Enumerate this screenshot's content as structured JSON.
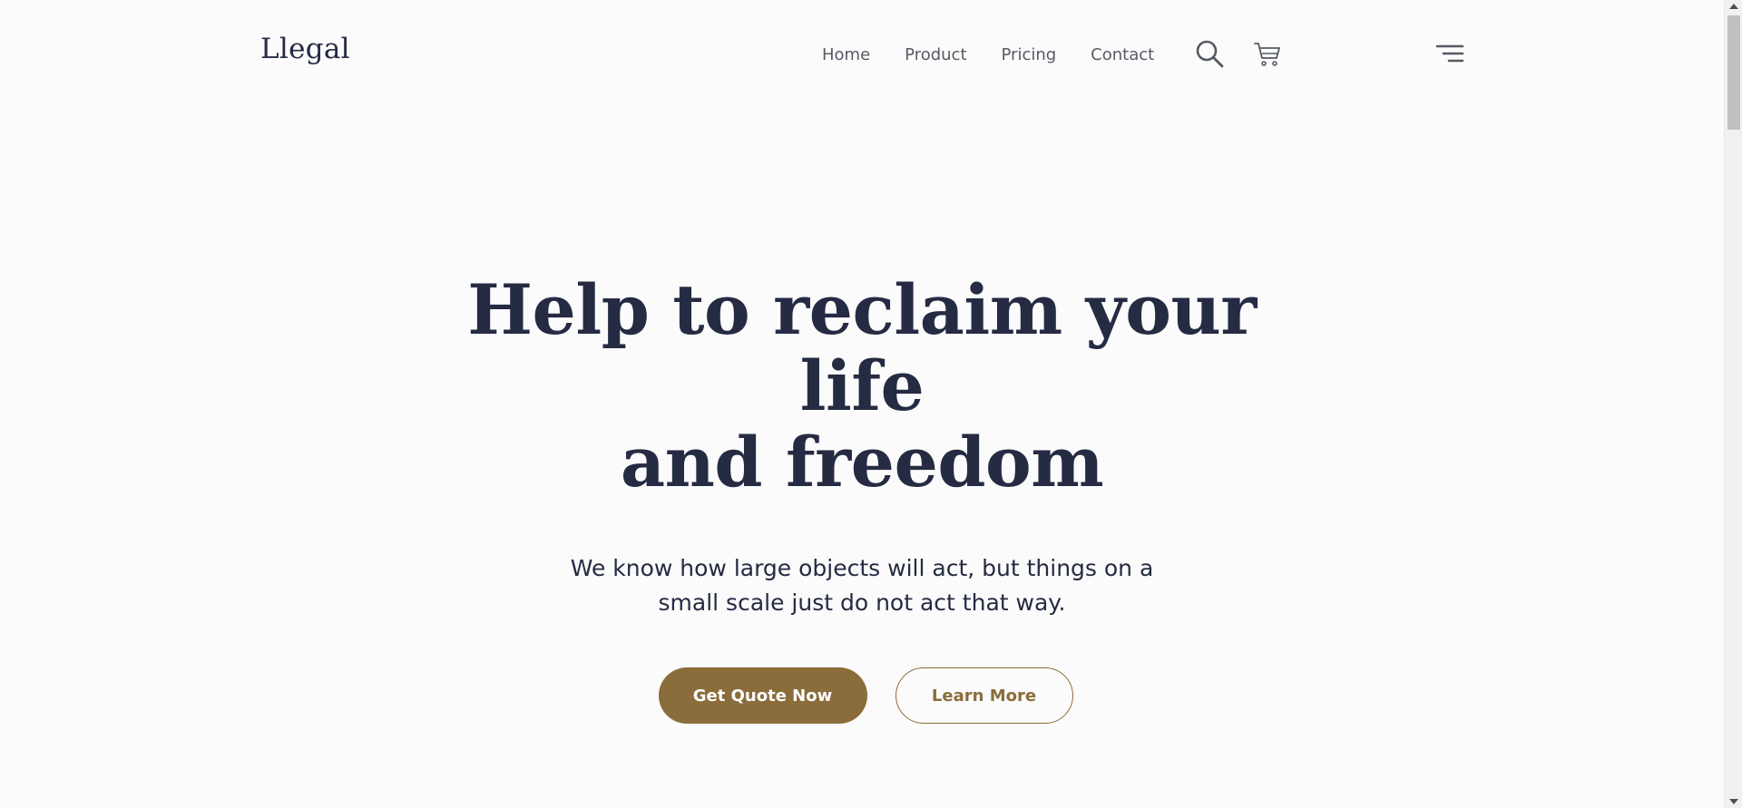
{
  "header": {
    "logo": "Llegal",
    "nav": [
      {
        "label": "Home"
      },
      {
        "label": "Product"
      },
      {
        "label": "Pricing"
      },
      {
        "label": "Contact"
      }
    ],
    "icons": {
      "search": "search-icon",
      "cart": "cart-icon",
      "menu": "menu-icon"
    }
  },
  "hero": {
    "title_line1": "Help to reclaim your life",
    "title_line2": "and freedom",
    "subtitle_line1": "We know how large objects will act, but things on a",
    "subtitle_line2": "small scale just do not act that way.",
    "primary_cta": "Get Quote Now",
    "secondary_cta": "Learn More"
  },
  "colors": {
    "background": "#fbfbfb",
    "text_dark": "#252b42",
    "nav_text": "#555a64",
    "accent": "#8a6d3b"
  }
}
